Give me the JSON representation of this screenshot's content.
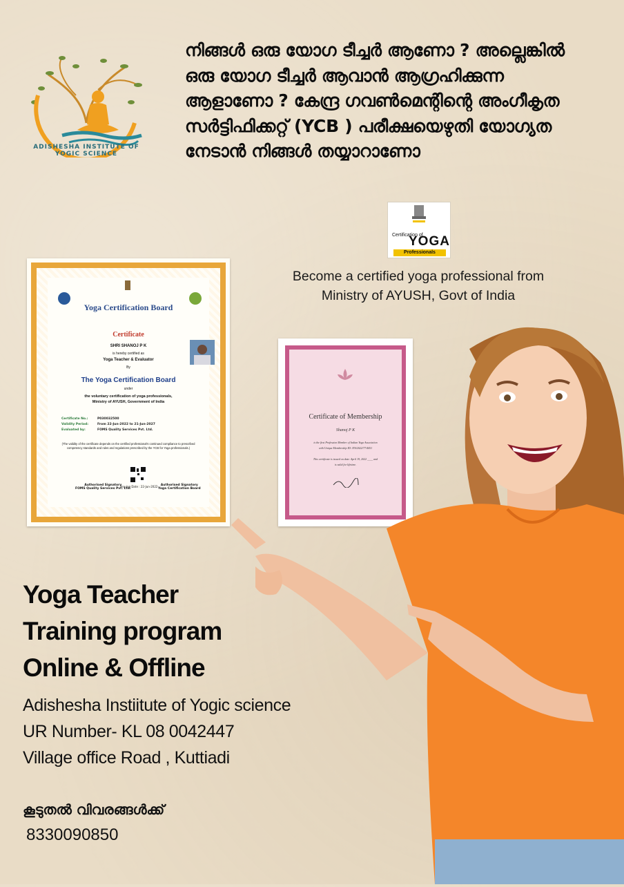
{
  "logo": {
    "caption": "ADISHESHA INSTITUTE OF YOGIC SCIENCE"
  },
  "headline": {
    "lines": [
      "നിങ്ങൾ ഒരു യോഗ ടീച്ചർ ആണോ ? അല്ലെങ്കിൽ",
      "ഒരു യോഗ ടീച്ചർ ആവാൻ ആഗ്രഹിക്കുന്ന",
      "ആളാണോ ? കേന്ദ്ര ഗവൺമെന്റിന്റെ അംഗീകൃത",
      "സർട്ടിഫിക്കറ്റ് (YCB ) പരീക്ഷയെഴുതി യോഗ്യത",
      "നേടാൻ നിങ്ങൾ തയ്യാറാണോ"
    ]
  },
  "ycb": {
    "badge_top": "Certification of",
    "badge_main": "YOGA",
    "badge_bottom": "Professionals",
    "line1": "Become a certified yoga professional from",
    "line2": "Ministry of  AYUSH, Govt of India"
  },
  "cert1": {
    "board": "Yoga Certification Board",
    "title": "Certificate",
    "name": "SHRI SHANOJ P K",
    "certified_as": "is hereby certified as",
    "role": "Yoga Teacher & Evaluator",
    "by": "By",
    "board_big": "The Yoga Certification Board",
    "under": "under",
    "scheme1": "the voluntary certification of yoga professionals,",
    "scheme2": "Ministry of AYUSH, Government of India",
    "rows": [
      {
        "k": "Certificate No.:",
        "v": "P030032500"
      },
      {
        "k": "Validity Period:",
        "v": "From 22-Jun-2022 to 21-Jun-2027"
      },
      {
        "k": "Evaluated by:",
        "v": "FOMS Quality Services Pvt. Ltd."
      }
    ],
    "note": "(The validity of the certificate depends on the certified professional's continued compliance to prescribed competency standards and rules and regulations prescribed by the YCB for Yoga professionals.)",
    "sig_left": "Authorised Signatory",
    "sig_left_org": "FOMS Quality Services Pvt. Ltd.",
    "sig_right": "Authorised Signatory",
    "sig_right_org": "Yoga Certification Board",
    "issue": "Issuing Date : 22-Jun-2022"
  },
  "cert2": {
    "title": "Certificate of Membership",
    "name": "Shanoj P K",
    "line1": "is the first Profession Member of Indian Yoga Association",
    "line2": "with Unique Membership ID: IYA/2022/77/4451",
    "line3": "This certificate is issued on date: April 19, 2022 ____ and",
    "line4": "is valid for lifetime."
  },
  "program": {
    "line1": "Yoga Teacher",
    "line2": "Training program",
    "line3": "Online & Offline"
  },
  "address": {
    "line1": "Adishesha Instiitute of Yogic science",
    "line2": "UR Number- KL 08 0042447",
    "line3": "Village office Road , Kuttiadi"
  },
  "contact": {
    "label": "കൂടുതൽ വിവരങ്ങൾക്ക്",
    "phone": "8330090850"
  },
  "colors": {
    "background": "#e9dcc6",
    "logo_orange": "#f0a020",
    "logo_teal": "#2a8a9a",
    "shirt_orange": "#f4862a",
    "cert_border": "#e8a63a",
    "cert_pink": "#c65a8a"
  }
}
